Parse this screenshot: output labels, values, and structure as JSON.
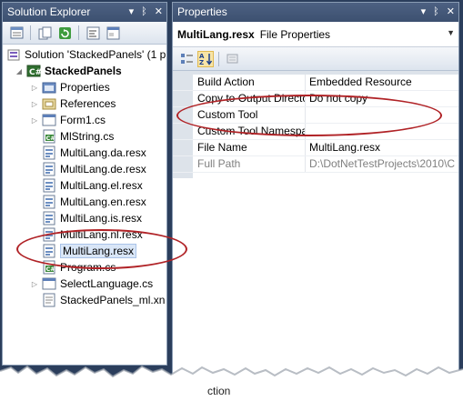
{
  "solution_explorer": {
    "title": "Solution Explorer",
    "title_ctrls": {
      "pin": "▾ ᛫",
      "close": "×"
    },
    "solution_label": "Solution 'StackedPanels' (1 p",
    "project_label": "StackedPanels",
    "items": [
      {
        "label": "Properties",
        "icon": "properties-folder-icon"
      },
      {
        "label": "References",
        "icon": "references-icon"
      },
      {
        "label": "Form1.cs",
        "icon": "form-icon"
      },
      {
        "label": "MlString.cs",
        "icon": "csharp-file-icon"
      },
      {
        "label": "MultiLang.da.resx",
        "icon": "resx-file-icon"
      },
      {
        "label": "MultiLang.de.resx",
        "icon": "resx-file-icon"
      },
      {
        "label": "MultiLang.el.resx",
        "icon": "resx-file-icon"
      },
      {
        "label": "MultiLang.en.resx",
        "icon": "resx-file-icon"
      },
      {
        "label": "MultiLang.is.resx",
        "icon": "resx-file-icon"
      },
      {
        "label": "MultiLang.nl.resx",
        "icon": "resx-file-icon"
      },
      {
        "label": "MultiLang.resx",
        "icon": "resx-file-icon"
      },
      {
        "label": "Program.cs",
        "icon": "csharp-file-icon"
      },
      {
        "label": "SelectLanguage.cs",
        "icon": "form-icon"
      },
      {
        "label": "StackedPanels_ml.xn",
        "icon": "xml-file-icon"
      }
    ]
  },
  "properties": {
    "title": "Properties",
    "object_name": "MultiLang.resx",
    "object_type": "File Properties",
    "rows": [
      {
        "name": "Build Action",
        "value": "Embedded Resource"
      },
      {
        "name": "Copy to Output Directo",
        "value": "Do not copy"
      },
      {
        "name": "Custom Tool",
        "value": ""
      },
      {
        "name": "Custom Tool Namespa",
        "value": ""
      }
    ],
    "rows2": [
      {
        "name": "File Name",
        "value": "MultiLang.resx"
      },
      {
        "name": "Full Path",
        "value": "D:\\DotNetTestProjects\\2010\\C"
      }
    ],
    "bottom_fragment": "ction"
  },
  "colors": {
    "title_bar": "#3c5070",
    "annotation": "#b02226",
    "selection": "#d9e6f7"
  }
}
